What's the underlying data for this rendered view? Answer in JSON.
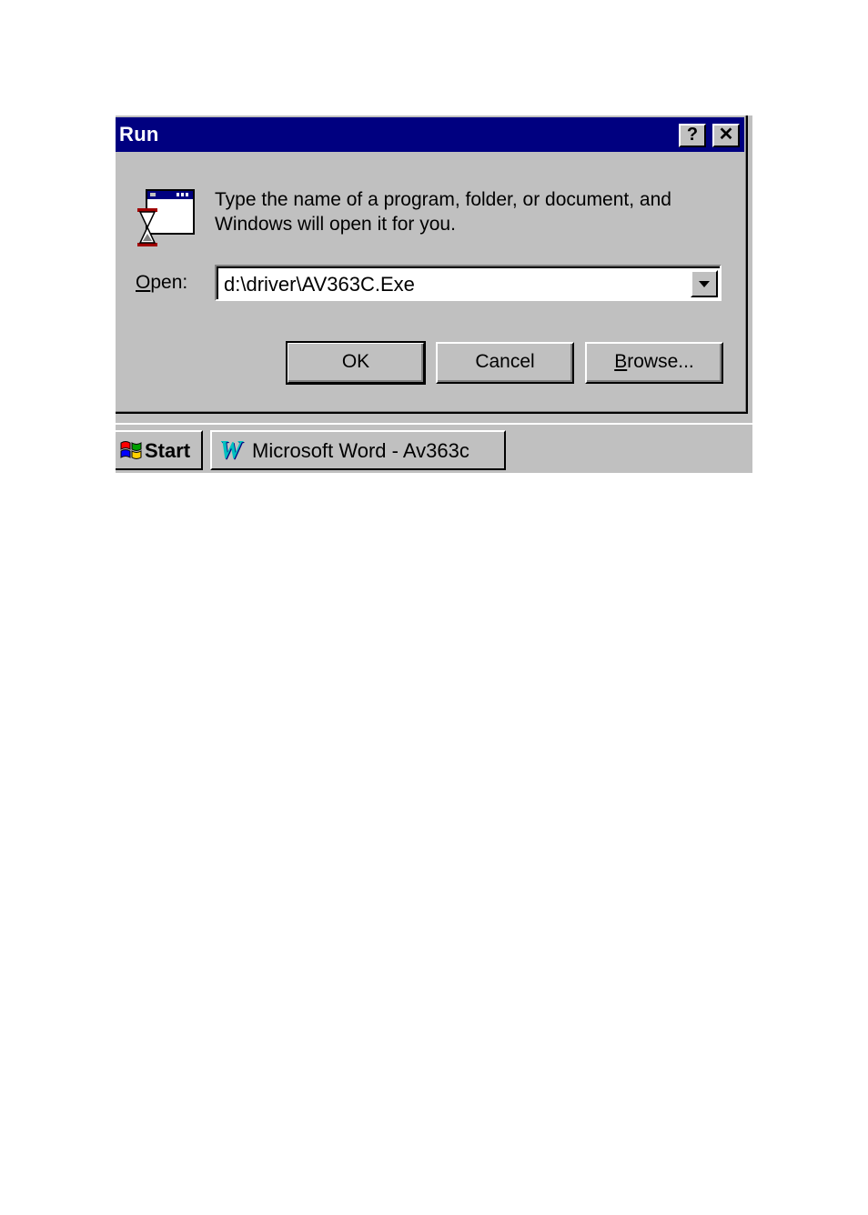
{
  "window": {
    "title": "Run",
    "help_glyph": "?",
    "close_glyph": "✕"
  },
  "dialog": {
    "description": "Type the name of a program, folder, or document, and Windows will open it for you.",
    "open_label_accel": "O",
    "open_label_rest": "pen:",
    "open_value": "d:\\driver\\AV363C.Exe",
    "buttons": {
      "ok": "OK",
      "cancel": "Cancel",
      "browse_accel": "B",
      "browse_rest": "rowse..."
    }
  },
  "taskbar": {
    "start_label": "Start",
    "task_label": "Microsoft Word - Av363c",
    "task_icon_glyph": "W"
  },
  "icons": [
    "run-program-icon",
    "help-icon",
    "close-icon",
    "chevron-down-icon",
    "windows-logo-icon",
    "word-icon"
  ],
  "colors": {
    "title_bar": "#000080",
    "face": "#c0c0c0"
  }
}
